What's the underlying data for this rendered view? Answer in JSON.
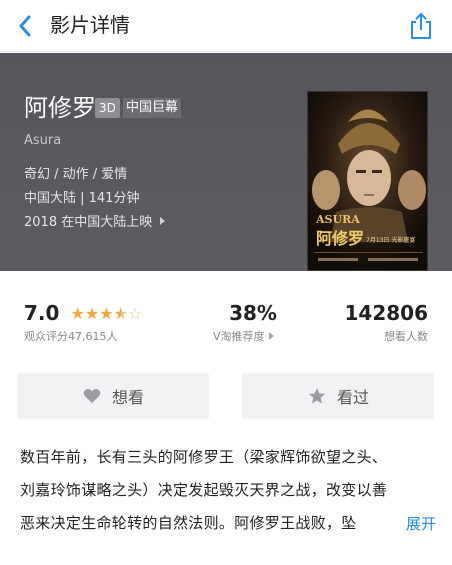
{
  "nav": {
    "title": "影片详情",
    "back_icon": "chevron-left-icon",
    "share_icon": "share-icon",
    "accent": "#2a8ee6"
  },
  "movie": {
    "title": "阿修罗",
    "badge_3d": "3D",
    "badge_imax": "中国巨幕",
    "english_title": "Asura",
    "genres": "奇幻 / 动作 / 爱情",
    "meta": "中国大陆 | 141分钟",
    "release": "2018 在中国大陆上映"
  },
  "stats": {
    "score": "7.0",
    "stars_filled": 3.5,
    "stars_total": 5,
    "score_sub": "观众评分47,615人",
    "rec_value": "38%",
    "rec_sub": "V淘推荐度",
    "want_value": "142806",
    "want_sub": "想看人数"
  },
  "buttons": {
    "want_label": "想看",
    "seen_label": "看过"
  },
  "synopsis": {
    "lines": [
      "数百年前，长有三头的阿修罗王（梁家辉饰欲望之头、",
      "刘嘉玲饰谋略之头）决定发起毁灭天界之战，改变以善",
      "恶来决定生命轮转的自然法则。阿修罗王战败，坠"
    ],
    "expand_label": "展开"
  },
  "poster": {
    "title_text": "ASURA",
    "cn_text": "阿修罗",
    "date_text": "7月13日 光影盛宴"
  }
}
